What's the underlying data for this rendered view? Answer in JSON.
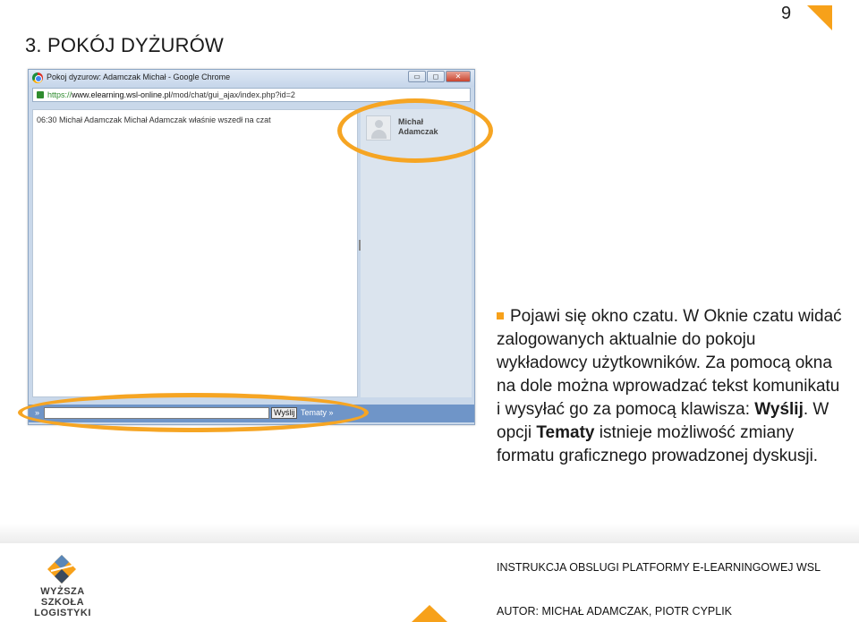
{
  "slide": {
    "title": "3. POKÓJ DYŻURÓW",
    "page_number": "9"
  },
  "window": {
    "title": "Pokoj dyzurow: Adamczak Michał - Google Chrome",
    "buttons": {
      "minimize": "▭",
      "maximize": "◻",
      "close": "✕"
    },
    "url_scheme": "https://",
    "url_host": "www.elearning.wsl-online.pl",
    "url_path": "/mod/chat/gui_ajax/index.php?id=2"
  },
  "chat": {
    "log_line_time": "06:30",
    "log_line_text": "Michał Adamczak Michał Adamczak właśnie wszedł na czat",
    "user_first": "Michał",
    "user_last": "Adamczak",
    "prompt_glyph": "»",
    "send_label": "Wyślij",
    "topics_label": "Tematy »",
    "input_value": ""
  },
  "description": {
    "part1": "Pojawi się okno czatu. W Oknie czatu widać zalogowanych aktualnie do pokoju wykładowcy użytkowników. Za pomocą okna na dole można wprowadzać tekst komunikatu i wysyłać go za pomocą klawisza: ",
    "bold1": "Wyślij",
    "part2": ". W opcji ",
    "bold2": "Tematy",
    "part3": " istnieje możliwość zmiany formatu graficznego prowadzonej dyskusji."
  },
  "footer": {
    "logo_line1": "WYŻSZA SZKOŁA",
    "logo_line2": "LOGISTYKI",
    "title": "INSTRUKCJA OBSLUGI PLATFORMY E-LEARNINGOWEJ WSL",
    "author": "AUTOR: MICHAŁ ADAMCZAK, PIOTR CYPLIK"
  },
  "colors": {
    "accent": "#f7a11a",
    "chat_bar": "#6f95c8",
    "user_panel": "#dbe4ee"
  }
}
